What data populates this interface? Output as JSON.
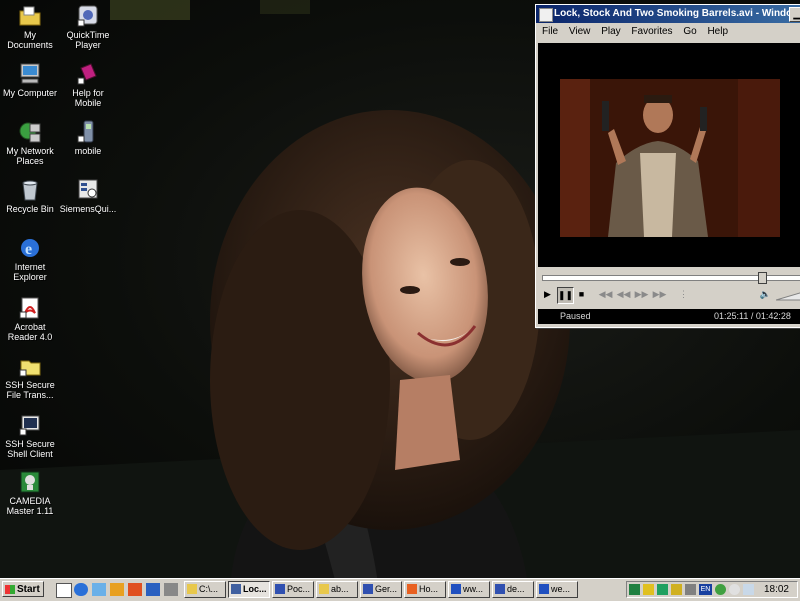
{
  "desktop": {
    "icons": [
      {
        "label": "My Documents",
        "icon": "folder-documents-icon"
      },
      {
        "label": "QuickTime Player",
        "icon": "quicktime-icon"
      },
      {
        "label": "My Computer",
        "icon": "computer-icon"
      },
      {
        "label": "Help for Mobile",
        "icon": "help-book-icon"
      },
      {
        "label": "My Network Places",
        "icon": "network-icon"
      },
      {
        "label": "mobile",
        "icon": "mobile-phone-icon"
      },
      {
        "label": "Recycle Bin",
        "icon": "recycle-bin-icon"
      },
      {
        "label": "SiemensQui...",
        "icon": "siemens-app-icon"
      },
      {
        "label": "Internet Explorer",
        "icon": "internet-explorer-icon"
      },
      {
        "label": "Acrobat Reader 4.0",
        "icon": "acrobat-icon"
      },
      {
        "label": "SSH Secure File Trans...",
        "icon": "ssh-file-transfer-icon"
      },
      {
        "label": "SSH Secure Shell Client",
        "icon": "ssh-shell-icon"
      },
      {
        "label": "CAMEDIA Master 1.11",
        "icon": "camedia-icon"
      }
    ]
  },
  "player": {
    "title": "Lock, Stock And Two Smoking Barrels.avi - Windo...",
    "menu": [
      "File",
      "View",
      "Play",
      "Favorites",
      "Go",
      "Help"
    ],
    "status": "Paused",
    "time": "01:25:11 / 01:42:28",
    "progress": 0.831,
    "accent": "#0a246a"
  },
  "taskbar": {
    "start_label": "Start",
    "tasks": [
      {
        "label": "C:\\...",
        "icon": "folder-icon"
      },
      {
        "label": "Loc...",
        "icon": "media-player-icon"
      },
      {
        "label": "Poc...",
        "icon": "document-icon"
      },
      {
        "label": "ab...",
        "icon": "explorer-window-icon"
      },
      {
        "label": "Ger...",
        "icon": "document-icon"
      },
      {
        "label": "Ho...",
        "icon": "browser-icon"
      },
      {
        "label": "ww...",
        "icon": "browser-icon"
      },
      {
        "label": "de...",
        "icon": "document-icon"
      },
      {
        "label": "we...",
        "icon": "browser-icon"
      }
    ],
    "tray": {
      "language": "EN",
      "clock": "18:02"
    }
  }
}
